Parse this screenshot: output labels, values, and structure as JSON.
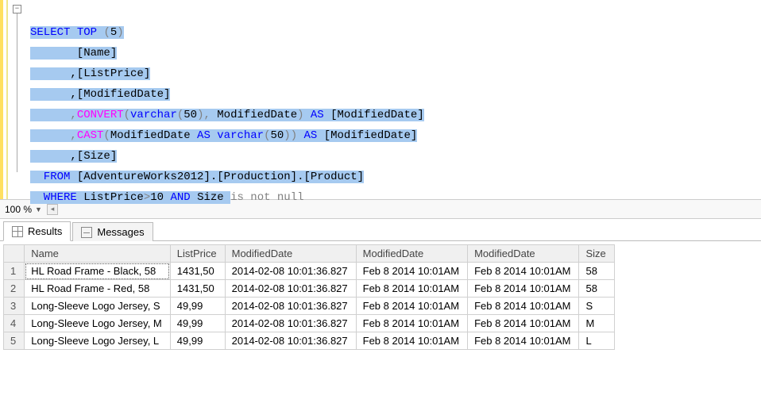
{
  "zoom": "100 %",
  "tabs": {
    "results": "Results",
    "messages": "Messages"
  },
  "sql": {
    "l1a": "SELECT",
    "l1b": " TOP ",
    "l1c": "(",
    "l1d": "5",
    "l1e": ")",
    "l2": "       [Name]",
    "l3": "      ,[ListPrice]",
    "l4": "      ,[ModifiedDate]",
    "l5a": "      ,",
    "l5b": "CONVERT",
    "l5c": "(",
    "l5d": "varchar",
    "l5e": "(",
    "l5f": "50",
    "l5g": "),",
    "l5h": " ModifiedDate",
    "l5i": ")",
    "l5j": " AS ",
    "l5k": "[ModifiedDate]",
    "l6a": "      ,",
    "l6b": "CAST",
    "l6c": "(",
    "l6d": "ModifiedDate ",
    "l6e": "AS",
    "l6f": " varchar",
    "l6g": "(",
    "l6h": "50",
    "l6i": "))",
    "l6j": " AS ",
    "l6k": "[ModifiedDate]",
    "l7": "      ,[Size]",
    "l8a": "  FROM",
    "l8b": " [AdventureWorks2012].[Production].[Product]",
    "l9a": "  WHERE",
    "l9b": " ListPrice",
    "l9c": ">",
    "l9d": "10 ",
    "l9e": "AND",
    "l9f": " Size ",
    "l9g": "is not null"
  },
  "grid": {
    "headers": [
      "",
      "Name",
      "ListPrice",
      "ModifiedDate",
      "ModifiedDate",
      "ModifiedDate",
      "Size"
    ],
    "rows": [
      [
        "1",
        "HL Road Frame - Black, 58",
        "1431,50",
        "2014-02-08 10:01:36.827",
        "Feb  8 2014 10:01AM",
        "Feb  8 2014 10:01AM",
        "58"
      ],
      [
        "2",
        "HL Road Frame - Red, 58",
        "1431,50",
        "2014-02-08 10:01:36.827",
        "Feb  8 2014 10:01AM",
        "Feb  8 2014 10:01AM",
        "58"
      ],
      [
        "3",
        "Long-Sleeve Logo Jersey, S",
        "49,99",
        "2014-02-08 10:01:36.827",
        "Feb  8 2014 10:01AM",
        "Feb  8 2014 10:01AM",
        "S"
      ],
      [
        "4",
        "Long-Sleeve Logo Jersey, M",
        "49,99",
        "2014-02-08 10:01:36.827",
        "Feb  8 2014 10:01AM",
        "Feb  8 2014 10:01AM",
        "M"
      ],
      [
        "5",
        "Long-Sleeve Logo Jersey, L",
        "49,99",
        "2014-02-08 10:01:36.827",
        "Feb  8 2014 10:01AM",
        "Feb  8 2014 10:01AM",
        "L"
      ]
    ]
  }
}
